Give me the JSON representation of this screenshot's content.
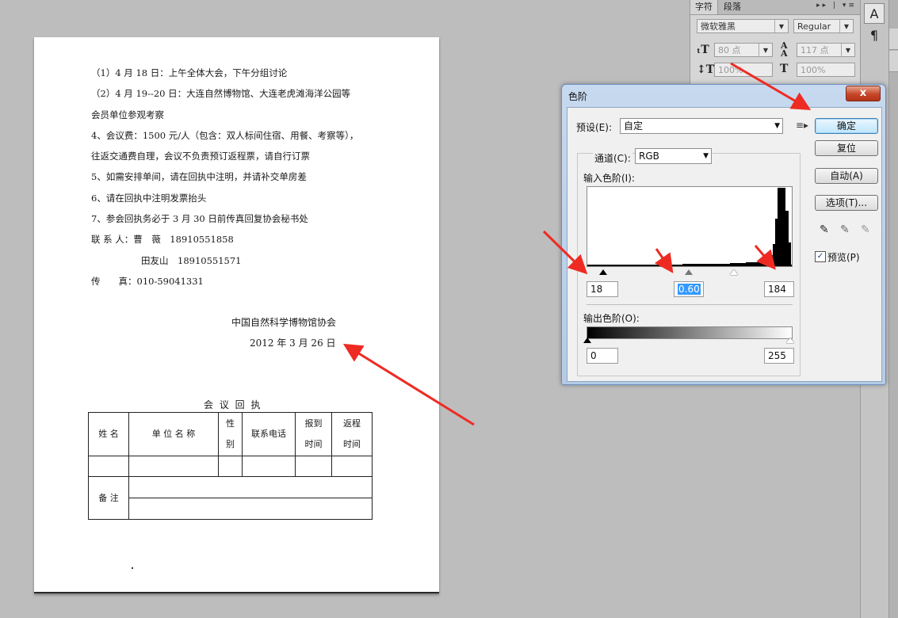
{
  "document": {
    "lines": [
      "（1）4 月 18 日：上午全体大会，下午分组讨论",
      "（2）4 月 19--20 日：大连自然博物馆、大连老虎滩海洋公园等",
      "会员单位参观考察",
      "4、会议费：1500 元/人（包含：双人标间住宿、用餐、考察等），",
      "往返交通费自理，会议不负责预订返程票，请自行订票",
      "5、如需安排单间，请在回执中注明，并请补交单房差",
      "6、请在回执中注明发票抬头",
      "7、参会回执务必于 3 月 30 日前传真回复协会秘书处",
      "联 系 人：曹　薇　18910551858",
      "田友山　18910551571",
      "传　　真：010-59041331"
    ],
    "org": "中国自然科学博物馆协会",
    "date": "2012 年 3 月 26 日",
    "receipt_title": "会 议 回 执",
    "table_headers": {
      "name": "姓 名",
      "unit": "单 位 名 称",
      "gender_1": "性",
      "gender_2": "别",
      "phone": "联系电话",
      "arrive_1": "报到",
      "arrive_2": "时间",
      "return_1": "返程",
      "return_2": "时间"
    },
    "remarks": "备 注"
  },
  "char_panel": {
    "tab_char": "字符",
    "tab_para": "段落",
    "panel_ctrl": "▸▸ | ▾≡",
    "font_family": "微软雅黑",
    "font_style": "Regular",
    "font_size": "80 点",
    "leading": "117 点",
    "v_scale": "100%",
    "h_scale": "100%"
  },
  "levels_dialog": {
    "title": "色阶",
    "close": "x",
    "preset_label": "预设(E):",
    "preset_value": "自定",
    "channel_label": "通道(C):",
    "channel_value": "RGB",
    "input_label": "输入色阶(I):",
    "input_black": "18",
    "input_gamma": "0.60",
    "input_white": "184",
    "output_label": "输出色阶(O):",
    "output_black": "0",
    "output_white": "255",
    "buttons": {
      "ok": "确定",
      "reset": "复位",
      "auto": "自动(A)",
      "options": "选项(T)..."
    },
    "preview_label": "预览(P)",
    "preview_checked": true
  },
  "colors": {
    "arrow": "#ee2b23",
    "dialog_frame": "#b5cbe6",
    "ok_button": "#bee6fd"
  }
}
